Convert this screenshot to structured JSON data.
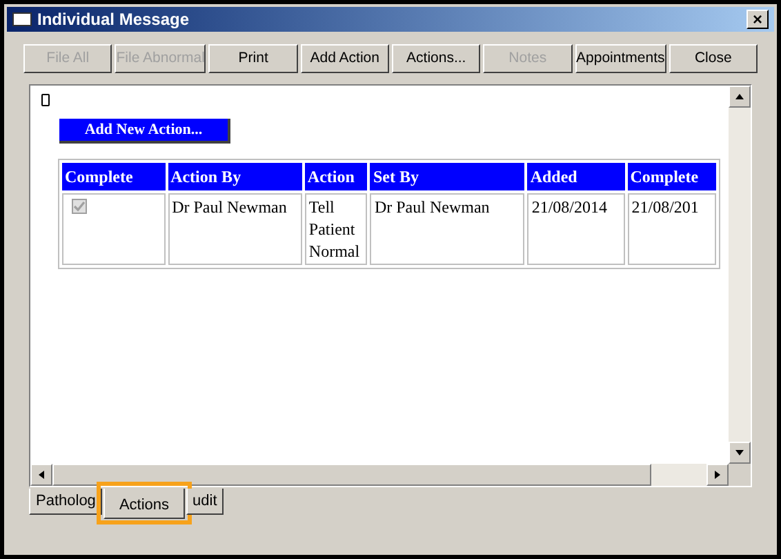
{
  "window": {
    "title": "Individual Message",
    "close": "×"
  },
  "toolbar": [
    {
      "label": "File All",
      "disabled": true
    },
    {
      "label": "File Abnormal",
      "disabled": true
    },
    {
      "label": "Print",
      "disabled": false
    },
    {
      "label": "Add Action",
      "disabled": false
    },
    {
      "label": "Actions...",
      "disabled": false
    },
    {
      "label": "Notes",
      "disabled": true
    },
    {
      "label": "Appointments",
      "disabled": false
    },
    {
      "label": "Close",
      "disabled": false
    }
  ],
  "add_button": "Add New Action...",
  "table": {
    "columns": [
      "Complete",
      "Action By",
      "Action",
      "Set By",
      "Added",
      "Complete"
    ],
    "rows": [
      {
        "cells": [
          {
            "kind": "checkbox",
            "checked": true,
            "disabled": true
          },
          {
            "kind": "text",
            "text": "Dr Paul Newman"
          },
          {
            "kind": "text",
            "text": "Tell Patient Normal"
          },
          {
            "kind": "text",
            "text": "Dr Paul Newman"
          },
          {
            "kind": "text",
            "text": "21/08/2014"
          },
          {
            "kind": "text",
            "text": "21/08/201"
          }
        ]
      }
    ]
  },
  "tabs": [
    {
      "label": "Patholog",
      "selected": false
    },
    {
      "label": "Actions",
      "selected": true,
      "highlighted": true
    },
    {
      "label": "udit",
      "selected": false
    }
  ]
}
